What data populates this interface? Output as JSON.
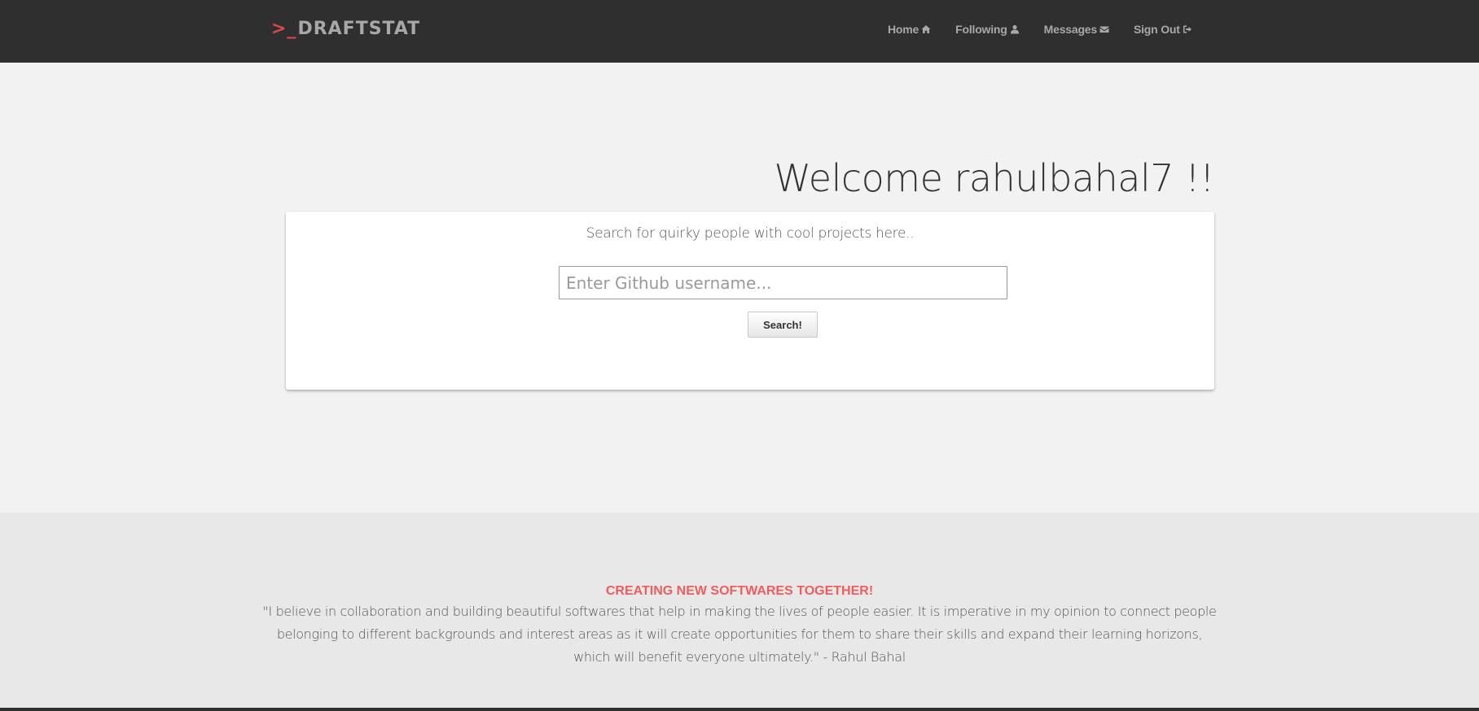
{
  "navbar": {
    "brand_prompt": ">_",
    "brand_name": "DRAFTSTAT",
    "items": [
      {
        "label": "Home",
        "icon": "home-icon"
      },
      {
        "label": "Following",
        "icon": "user-icon"
      },
      {
        "label": "Messages",
        "icon": "envelope-icon"
      },
      {
        "label": "Sign Out",
        "icon": "sign-out-icon"
      }
    ]
  },
  "hero": {
    "welcome": "Welcome rahulbahal7 !!"
  },
  "search": {
    "subtitle": "Search for quirky people with cool projects here..",
    "placeholder": "Enter Github username...",
    "button_label": "Search!"
  },
  "about": {
    "title": "CREATING NEW SOFTWARES TOGETHER!",
    "quote": "\"I believe in collaboration and building beautiful softwares that help in making the lives of people easier. It is imperative in my opinion to connect people belonging to different backgrounds and interest areas as it will create opportunities for them to share their skills and expand their learning horizons, which will benefit everyone ultimately.\" - Rahul Bahal"
  },
  "colors": {
    "navbar_bg": "#2f2f2f",
    "accent": "#ef5d5d",
    "page_bg": "#f2f2f2",
    "about_bg": "#e8e8e8"
  }
}
